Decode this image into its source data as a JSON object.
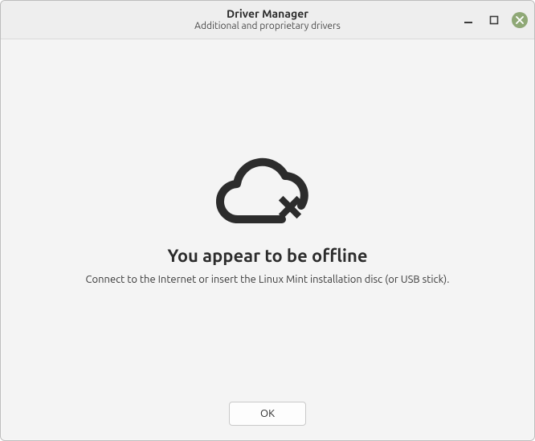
{
  "titlebar": {
    "title": "Driver Manager",
    "subtitle": "Additional and proprietary drivers"
  },
  "content": {
    "heading": "You appear to be offline",
    "subtext": "Connect to the Internet or insert the Linux Mint installation disc (or USB stick)."
  },
  "footer": {
    "ok_label": "OK"
  },
  "icons": {
    "offline_cloud": "cloud-offline-icon",
    "minimize": "minimize-icon",
    "maximize": "maximize-icon",
    "close": "close-icon"
  }
}
